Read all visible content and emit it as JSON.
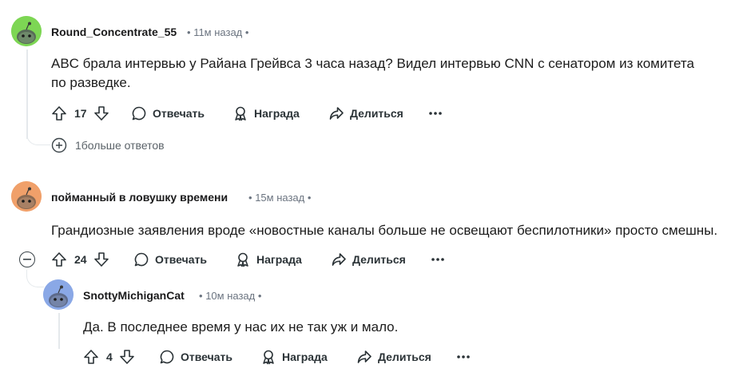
{
  "comments": [
    {
      "username": "Round_Concentrate_55",
      "time": "11м назад",
      "text": "ABC брала интервью у Райана Грейвса 3 часа назад? Видел интервью CNN с сенатором из комитета по разведке.",
      "votes": "17",
      "avatar_color": "#7dd654",
      "more_replies": "1больше ответов"
    },
    {
      "username": "пойманный в ловушку времени",
      "time": "15м назад",
      "text": "Грандиозные заявления вроде «новостные каналы больше не освещают беспилотники» просто смешны.",
      "votes": "24",
      "avatar_color": "#f0a06a"
    },
    {
      "username": "SnottyMichiganCat",
      "time": "10м назад",
      "text": "Да. В последнее время у нас их не так уж и мало.",
      "votes": "4",
      "avatar_color": "#8aa8e6"
    }
  ],
  "actions": {
    "reply": "Отвечать",
    "award": "Награда",
    "share": "Делиться"
  },
  "separator": "•"
}
